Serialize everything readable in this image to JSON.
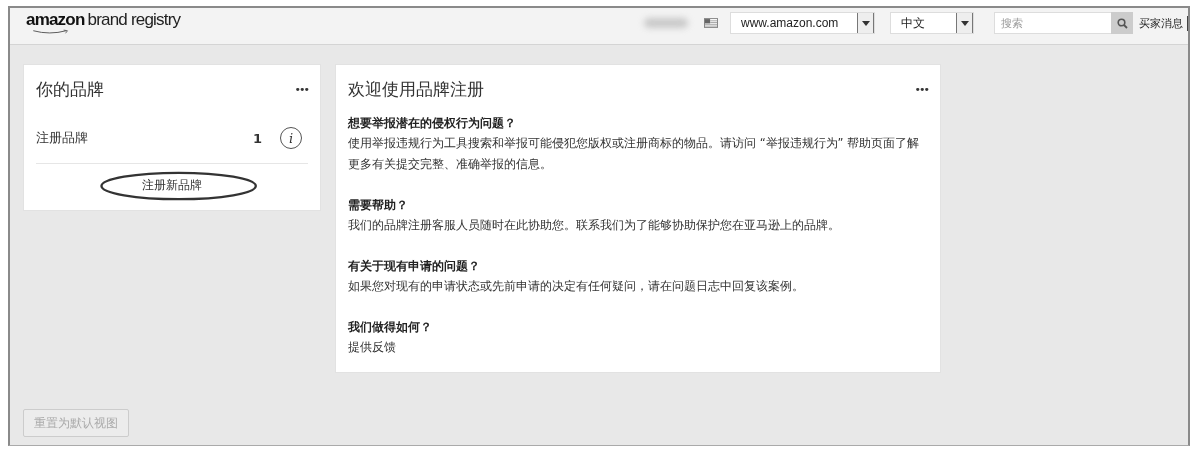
{
  "header": {
    "logo": {
      "brand": "amazon",
      "product": "brand registry"
    },
    "marketplace": {
      "value": "www.amazon.com"
    },
    "language": {
      "value": "中文"
    },
    "search": {
      "placeholder": "搜索"
    },
    "buyer_messages": "买家消息"
  },
  "brands_card": {
    "title": "你的品牌",
    "menu": "•••",
    "rows": [
      {
        "label": "注册品牌",
        "count": "1",
        "info": "i"
      }
    ],
    "action": "注册新品牌",
    "action_circled": true
  },
  "welcome_card": {
    "title": "欢迎使用品牌注册",
    "menu": "•••",
    "sections": [
      {
        "heading": "想要举报潜在的侵权行为问题？",
        "body": [
          {
            "kind": "text",
            "text": "使用"
          },
          {
            "kind": "link",
            "text": "举报违规行为"
          },
          {
            "kind": "text",
            "text": "工具搜索和举报可能侵犯您版权或注册商标的物品。请访问 “举报违规行为” 帮助页面了解更多有关提交完整、准确举报的信息。"
          }
        ]
      },
      {
        "heading": "需要帮助？",
        "body": [
          {
            "kind": "text",
            "text": "我们的品牌注册客服人员随时在此协助您。联系我们为了能够协助保护您在亚马逊上的品牌。"
          }
        ]
      },
      {
        "heading": "有关于现有申请的问题？",
        "body": [
          {
            "kind": "text",
            "text": "如果您对现有的申请状态或先前申请的决定有任何疑问，请在"
          },
          {
            "kind": "link",
            "text": "问题日志"
          },
          {
            "kind": "text",
            "text": "中回复该案例。"
          }
        ]
      },
      {
        "heading": "我们做得如何？",
        "body": [
          {
            "kind": "text",
            "text": "提供反馈"
          }
        ]
      }
    ]
  },
  "reset_button": "重置为默认视图"
}
